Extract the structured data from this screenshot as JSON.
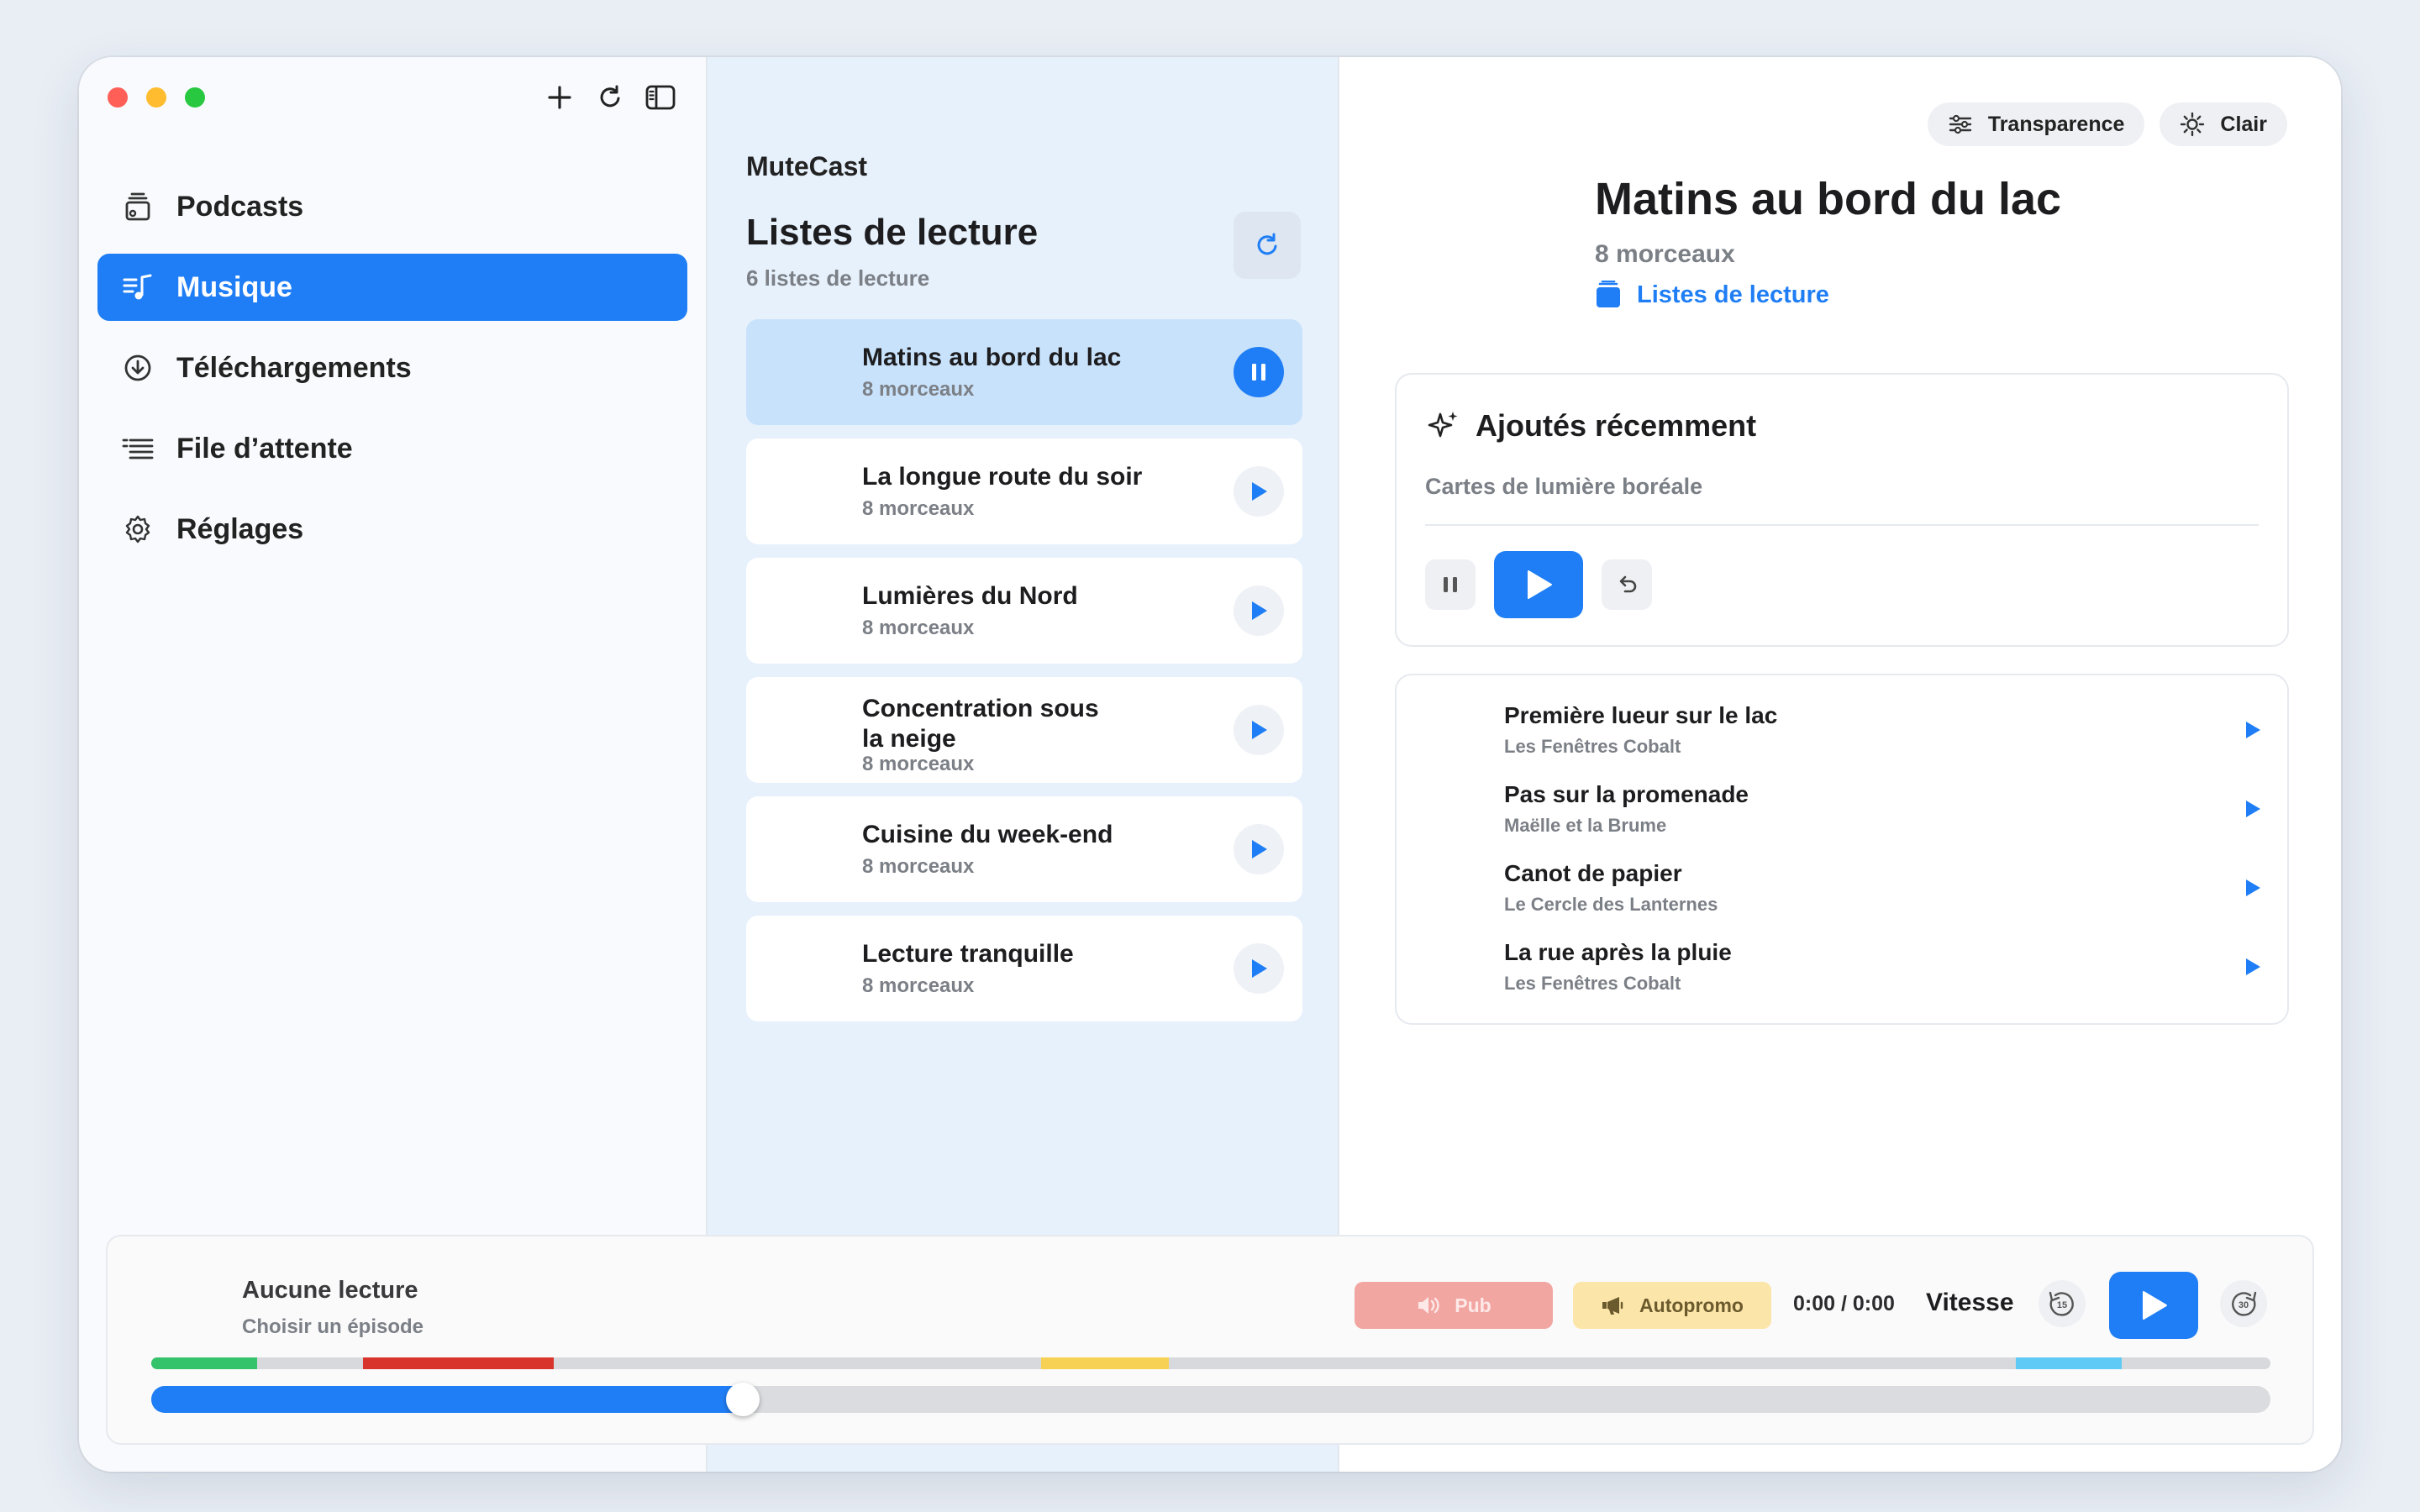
{
  "sidebar": {
    "items": [
      {
        "label": "Podcasts",
        "icon": "podcast-stack-icon",
        "active": false
      },
      {
        "label": "Musique",
        "icon": "music-list-icon",
        "active": true
      },
      {
        "label": "Téléchargements",
        "icon": "download-circle-icon",
        "active": false
      },
      {
        "label": "File d’attente",
        "icon": "queue-list-icon",
        "active": false
      },
      {
        "label": "Réglages",
        "icon": "gear-icon",
        "active": false
      }
    ]
  },
  "middle": {
    "app_name": "MuteCast",
    "title": "Listes de lecture",
    "count": "6 listes de lecture",
    "playlists": [
      {
        "title": "Matins au bord du lac",
        "sub": "8 morceaux",
        "state": "playing"
      },
      {
        "title": "La longue route du soir",
        "sub": "8 morceaux",
        "state": "paused"
      },
      {
        "title": "Lumières du Nord",
        "sub": "8 morceaux",
        "state": "paused"
      },
      {
        "title": "Concentration sous la neige",
        "sub": "8 morceaux",
        "state": "paused"
      },
      {
        "title": "Cuisine du week-end",
        "sub": "8 morceaux",
        "state": "paused"
      },
      {
        "title": "Lecture tranquille",
        "sub": "8 morceaux",
        "state": "paused"
      }
    ]
  },
  "right": {
    "pills": {
      "transparency": "Transparence",
      "theme": "Clair"
    },
    "title": "Matins au bord du lac",
    "count": "8 morceaux",
    "link": "Listes de lecture",
    "recent": {
      "title": "Ajoutés récemment",
      "sub": "Cartes de lumière boréale"
    },
    "tracks": [
      {
        "title": "Première lueur sur le lac",
        "artist": "Les Fenêtres Cobalt"
      },
      {
        "title": "Pas sur la promenade",
        "artist": "Maëlle et la Brume"
      },
      {
        "title": "Canot de papier",
        "artist": "Le Cercle des Lanternes"
      },
      {
        "title": "La rue après la pluie",
        "artist": "Les Fenêtres Cobalt"
      }
    ]
  },
  "player": {
    "title": "Aucune lecture",
    "sub": "Choisir un épisode",
    "ad_label": "Pub",
    "promo_label": "Autopromo",
    "time": "0:00 / 0:00",
    "speed_label": "Vitesse",
    "skip_back": "15",
    "skip_forward": "30",
    "progress_fraction": 0.279,
    "segments": [
      {
        "start": 0.0,
        "end": 0.05,
        "color": "#34c26a"
      },
      {
        "start": 0.1,
        "end": 0.19,
        "color": "#d8342c"
      },
      {
        "start": 0.42,
        "end": 0.48,
        "color": "#f7d154"
      },
      {
        "start": 0.88,
        "end": 0.93,
        "color": "#5fcaf5"
      }
    ]
  },
  "colors": {
    "accent": "#1f7ef5"
  }
}
